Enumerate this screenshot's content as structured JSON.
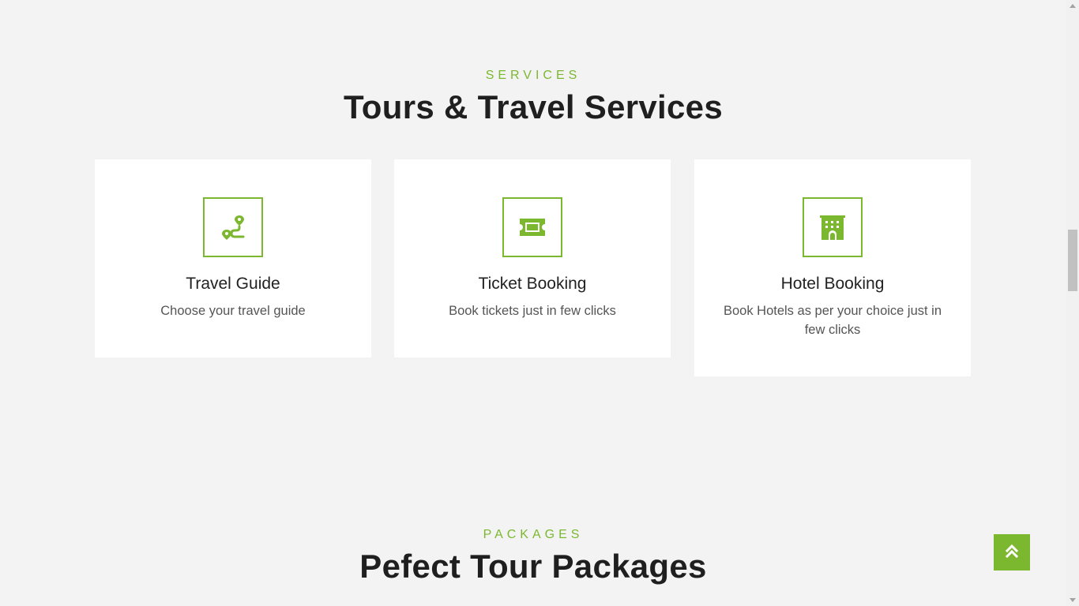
{
  "services": {
    "eyebrow": "SERVICES",
    "heading": "Tours & Travel Services",
    "cards": [
      {
        "icon": "route-icon",
        "title": "Travel Guide",
        "description": "Choose your travel guide"
      },
      {
        "icon": "ticket-icon",
        "title": "Ticket Booking",
        "description": "Book tickets just in few clicks"
      },
      {
        "icon": "hotel-icon",
        "title": "Hotel Booking",
        "description": "Book Hotels as per your choice just in few clicks"
      }
    ]
  },
  "packages": {
    "eyebrow": "PACKAGES",
    "heading": "Pefect Tour Packages"
  },
  "back_to_top": {
    "icon": "double-chevron-up-icon"
  },
  "colors": {
    "accent": "#7cb82f",
    "background": "#f3f3f3",
    "card": "#ffffff",
    "heading": "#1f1f1f"
  }
}
